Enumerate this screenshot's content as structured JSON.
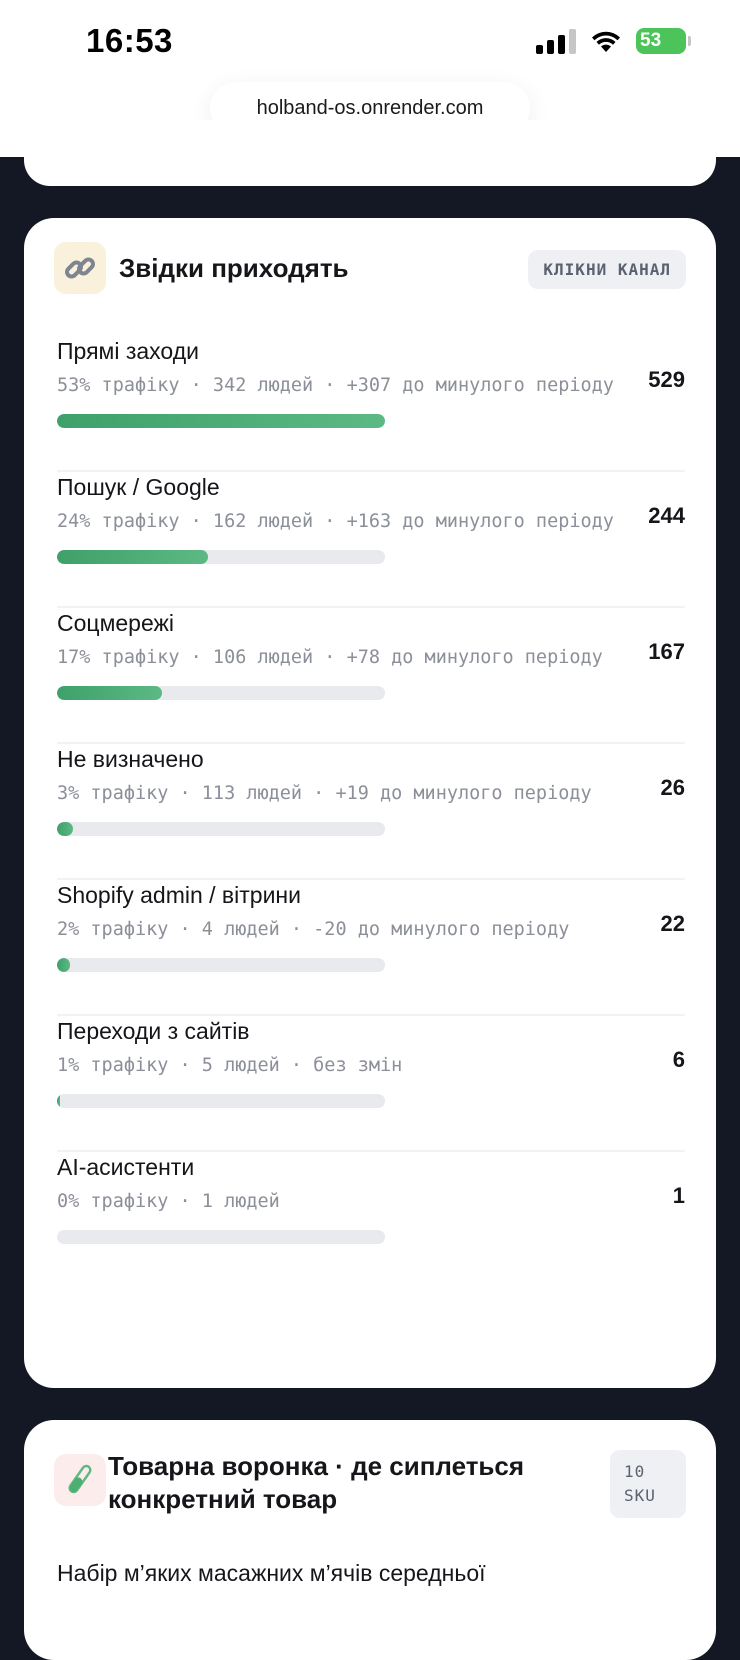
{
  "status_bar": {
    "time": "16:53",
    "battery": "53"
  },
  "browser": {
    "url": "holband-os.onrender.com"
  },
  "sources_card": {
    "icon": "link-icon",
    "title": "Звідки приходять",
    "chip": "КЛІКНИ КАНАЛ",
    "rows": [
      {
        "name": "Прямі заходи",
        "meta": "53% трафіку · 342 людей · +307 до минулого періоду",
        "count": "529",
        "share": 1.0
      },
      {
        "name": "Пошук / Google",
        "meta": "24% трафіку · 162 людей · +163 до минулого періоду",
        "count": "244",
        "share": 0.46
      },
      {
        "name": "Соцмережі",
        "meta": "17% трафіку · 106 людей · +78 до минулого періоду",
        "count": "167",
        "share": 0.32
      },
      {
        "name": "Не визначено",
        "meta": "3% трафіку · 113 людей · +19 до минулого періоду",
        "count": "26",
        "share": 0.05
      },
      {
        "name": "Shopify admin / вітрини",
        "meta": "2% трафіку · 4 людей · -20 до минулого періоду",
        "count": "22",
        "share": 0.04
      },
      {
        "name": "Переходи з сайтів",
        "meta": "1% трафіку · 5 людей · без змін",
        "count": "6",
        "share": 0.01
      },
      {
        "name": "AI-асистенти",
        "meta": "0% трафіку · 1 людей",
        "count": "1",
        "share": 0.0
      }
    ]
  },
  "funnel_card": {
    "icon": "test-tube-icon",
    "title": "Товарна воронка · де сиплеться конкретний товар",
    "chip": "10 SKU",
    "first_item": "Набір м’яких масажних м’ячів середньої"
  }
}
